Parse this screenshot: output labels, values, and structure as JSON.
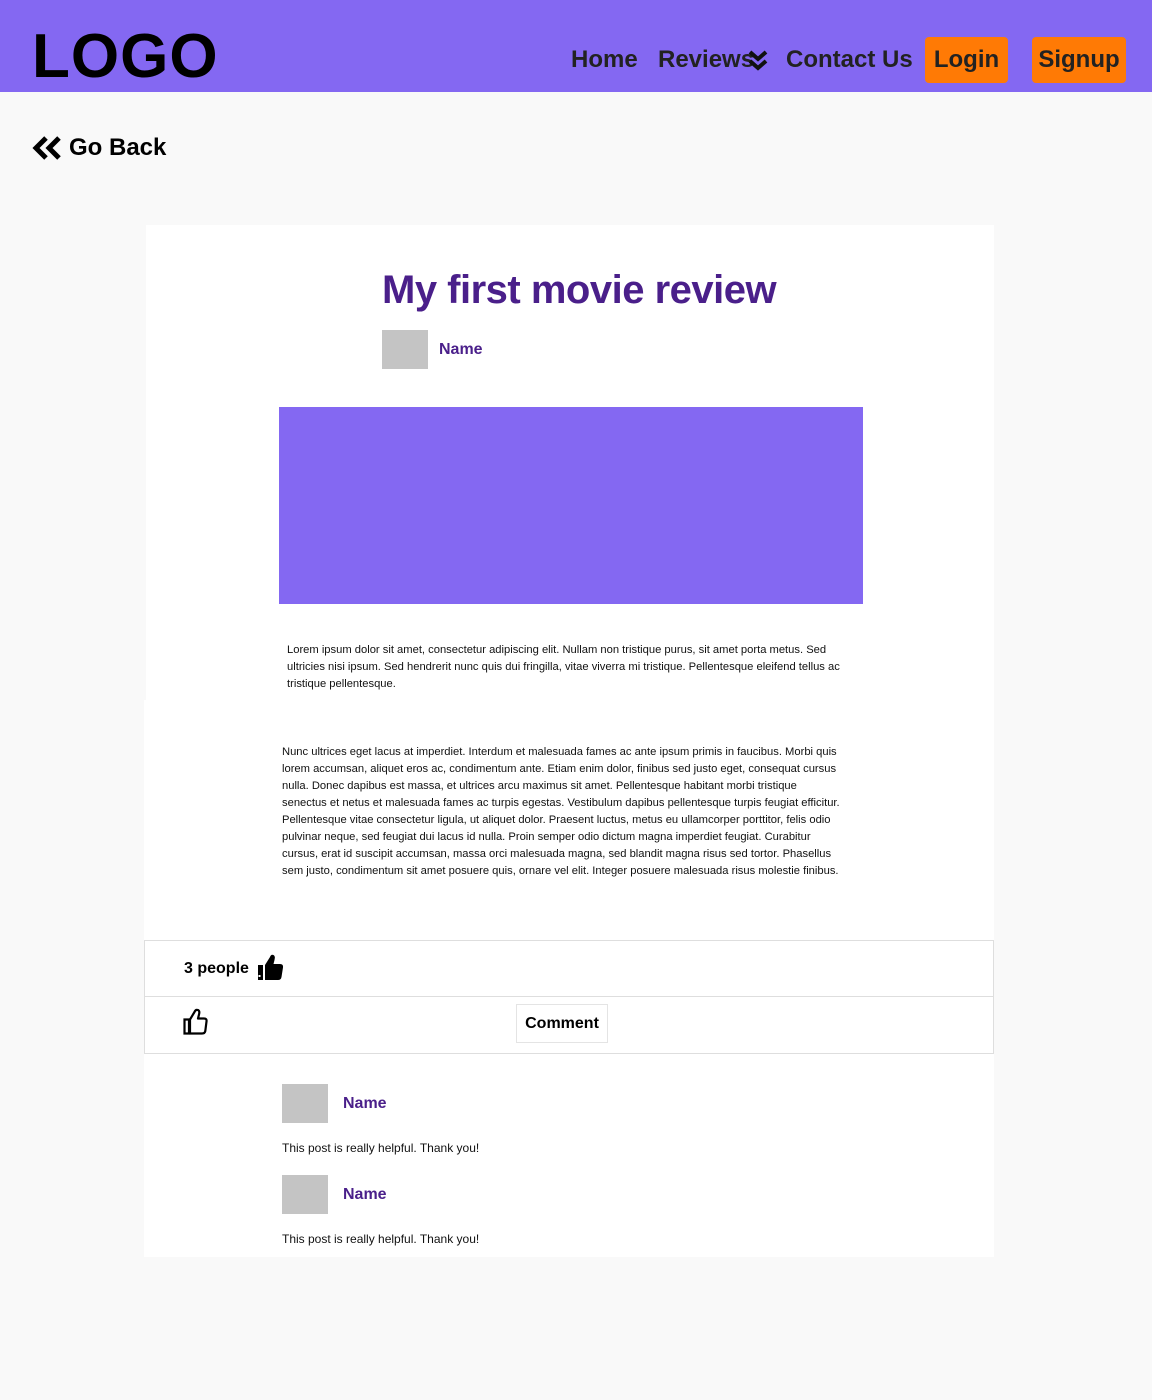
{
  "header": {
    "logo": "LOGO",
    "nav": {
      "home": "Home",
      "reviews": "Reviews",
      "contact": "Contact Us",
      "login": "Login",
      "signup": "Signup"
    },
    "colors": {
      "bar": "#8468f2",
      "button": "#ff7a05"
    }
  },
  "go_back": {
    "label": "Go Back",
    "icon": "double-chevron-left-icon"
  },
  "post": {
    "title": "My first movie review",
    "author": "Name",
    "paragraph_short": "Lorem ipsum dolor sit amet, consectetur adipiscing elit. Nullam non tristique purus, sit amet porta metus. Sed ultricies nisi ipsum. Sed hendrerit nunc quis dui fringilla, vitae viverra mi tristique. Pellentesque eleifend tellus ac tristique pellentesque.",
    "paragraph_long": "Nunc ultrices eget lacus at imperdiet. Interdum et malesuada fames ac ante ipsum primis in faucibus. Morbi quis lorem accumsan, aliquet eros ac, condimentum ante. Etiam enim dolor, finibus sed justo eget, consequat cursus nulla. Donec dapibus est massa, et ultrices arcu maximus sit amet. Pellentesque habitant morbi tristique senectus et netus et malesuada fames ac turpis egestas. Vestibulum dapibus pellentesque turpis feugiat efficitur. Pellentesque vitae consectetur ligula, ut aliquet dolor. Praesent luctus, metus eu ullamcorper porttitor, felis odio pulvinar neque, sed feugiat dui lacus id nulla. Proin semper odio dictum magna imperdiet feugiat. Curabitur cursus, erat id suscipit accumsan, massa orci malesuada magna, sed blandit magna risus sed tortor. Phasellus sem justo, condimentum sit amet posuere quis, ornare vel elit. Integer posuere malesuada risus molestie finibus."
  },
  "reactions": {
    "likes_text": "3 people",
    "likes_icon": "thumbs-up-filled-icon",
    "like_button_icon": "thumbs-up-outline-icon",
    "comment_label": "Comment"
  },
  "comments": [
    {
      "author": "Name",
      "text": "This post is really helpful. Thank you!"
    },
    {
      "author": "Name",
      "text": "This post is really helpful. Thank you!"
    }
  ]
}
